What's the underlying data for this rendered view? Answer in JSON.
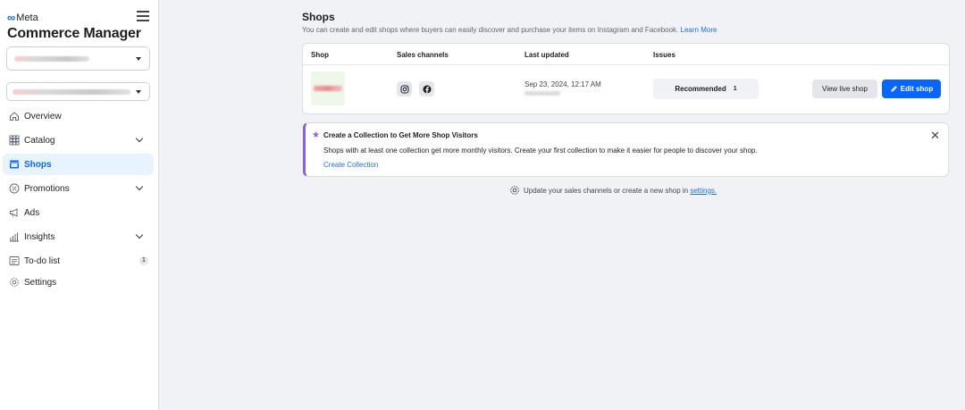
{
  "sidebar": {
    "brand": "Meta",
    "title": "Commerce Manager",
    "nav": [
      {
        "label": "Overview",
        "icon": "home-icon"
      },
      {
        "label": "Catalog",
        "icon": "grid-icon"
      },
      {
        "label": "Shops",
        "icon": "shop-icon"
      },
      {
        "label": "Promotions",
        "icon": "percent-icon"
      },
      {
        "label": "Ads",
        "icon": "megaphone-icon"
      },
      {
        "label": "Insights",
        "icon": "bar-chart-icon"
      },
      {
        "label": "To-do list",
        "icon": "list-icon",
        "count": "1"
      },
      {
        "label": "Settings",
        "icon": "gear-icon"
      }
    ]
  },
  "page": {
    "title": "Shops",
    "subtitle": "You can create and edit shops where buyers can easily discover and purchase your items on Instagram and Facebook.",
    "learn_more": "Learn More"
  },
  "shops_table": {
    "headers": [
      "Shop",
      "Sales channels",
      "Last updated",
      "Issues"
    ],
    "rows": [
      {
        "last_updated": "Sep 23, 2024, 12:17 AM",
        "issue_label": "Recommended",
        "issue_count": "1",
        "view_label": "View live shop",
        "edit_label": "Edit shop"
      }
    ]
  },
  "promo": {
    "title": "Create a Collection to Get More Shop Visitors",
    "body": "Shops with at least one collection get more monthly visitors. Create your first collection to make it easier for people to discover your shop.",
    "link": "Create Collection"
  },
  "footer": {
    "text": "Update your sales channels or create a new shop in",
    "link": "settings."
  },
  "colors": {
    "accent": "#0866ff",
    "promo_border": "#8a63d2",
    "active_bg": "#e7f3ff"
  }
}
